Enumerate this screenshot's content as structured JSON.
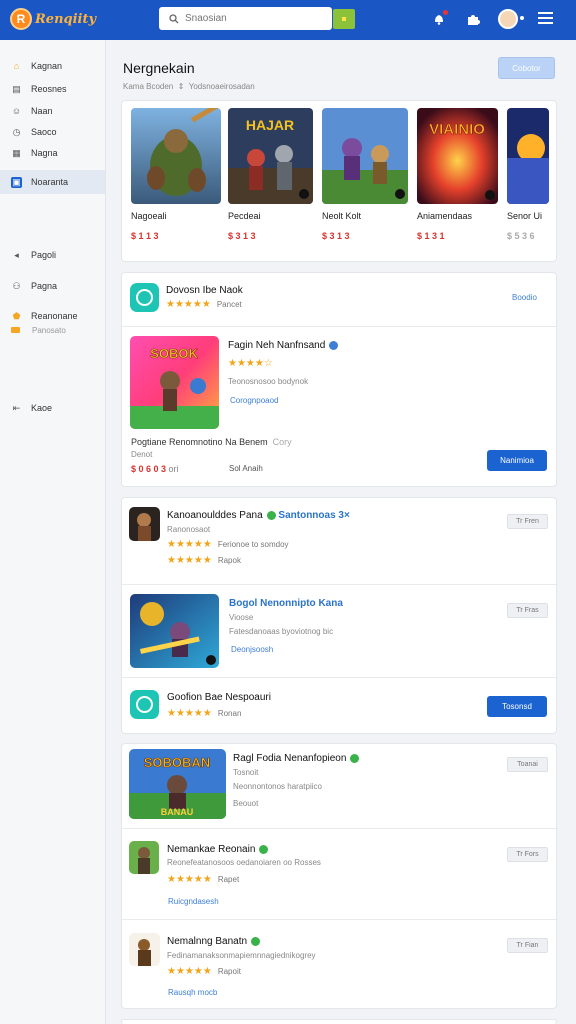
{
  "topbar": {
    "logo_text": "Renqiity",
    "logo_mark": "R",
    "search_placeholder": "Snaosian",
    "icons": [
      "notification-icon",
      "puzzle-icon",
      "avatar",
      "menu-icon"
    ]
  },
  "sidebar": {
    "items": [
      {
        "label": "Kagnan",
        "icon": "home-icon"
      },
      {
        "label": "Reosnes",
        "icon": "store-icon"
      },
      {
        "label": "Naan",
        "icon": "user-icon"
      },
      {
        "label": "Saoco",
        "icon": "clock-icon"
      },
      {
        "label": "Nagna",
        "icon": "grid-icon"
      },
      {
        "label": "Noaranta",
        "icon": "apps-icon"
      },
      {
        "label": "Pagoli",
        "icon": "back-icon"
      },
      {
        "label": "Pagna",
        "icon": "people-icon"
      },
      {
        "label": "Reanonane",
        "icon": "star-icon",
        "sub": "Panosato"
      },
      {
        "label": "Kaoe",
        "icon": "exit-icon"
      }
    ]
  },
  "header": {
    "title": "Nergnekain",
    "subtitle": "Kama Bcoden",
    "subtitle2": "Yodsnoaeirosadan",
    "button": "Cobotor"
  },
  "featured": [
    {
      "name": "Nagoeali",
      "price": "$ 1 1 3"
    },
    {
      "name": "Pecdeai",
      "price": "$ 3 1 3"
    },
    {
      "name": "Neolt Kolt",
      "price": "$ 3 1 3"
    },
    {
      "name": "Aniamendaas",
      "price": "$ 1 3 1"
    },
    {
      "name": "Senor Ui",
      "price": "$ 5 3 6"
    }
  ],
  "card2": {
    "app_title": "Dovosn Ibe Naok",
    "app_rating": "Pancet",
    "app_link": "Boodio",
    "game_title": "Fagin Neh Nanfnsand",
    "game_desc1": "Teonosnosoo bodynok",
    "game_link": "Corognpoaod",
    "meta_line": "Pogtiane Renomnotino Na Benem",
    "meta_trail": "Cory",
    "meta_sub": "Denot",
    "price": "$ 0 6 0 3",
    "price_unit": "ori",
    "sold": "Sol Anaih",
    "button": "Nanimioa"
  },
  "card3": {
    "row1_title": "Kanoanoulddes Pana",
    "row1_tag": "Santonnoas 3×",
    "row1_sub": "Ranonosaot",
    "row1_desc": "Ferionoe to somdoy",
    "row1_rating": "Rapok",
    "row1_btn": "Tr Fren",
    "row2_title": "Bogol Nenonnipto",
    "row2_tag": "Kana",
    "row2_sub": "Vioose",
    "row2_desc": "Fatesdanoaas byoviotnog bic",
    "row2_link": "Deonjsoosh",
    "row2_btn": "Tr Fras",
    "row3_title": "Goofion Bae Nespoauri",
    "row3_rating": "Ronan",
    "row3_btn": "Tosonsd"
  },
  "card4": {
    "row1_title": "Ragl Fodia Nenanfopieon",
    "row1_sub": "Tosnoit",
    "row1_desc": "Neonnontonos haratpiico",
    "row1_link": "Beouot",
    "row1_btn": "Toanai",
    "row2_title": "Nemankae Reonain",
    "row2_desc": "Reonefeatanosoos oedanoiaren oo Rosses",
    "row2_rating": "Rapet",
    "row2_link": "Ruicgndasesh",
    "row2_btn": "Tr Fors",
    "row3_title": "Nemalnng Banatn",
    "row3_desc": "Fedinamanaksonmapiemnnagiednikogrey",
    "row3_rating": "Rapoit",
    "row3_link": "Rausqh mocb",
    "row3_btn": "Tr Fian"
  },
  "colors": {
    "topbar": "#1a56c4",
    "accent": "#1a63d0",
    "price_red": "#d8322f",
    "star": "#f2a51a",
    "teal_icon": "#1ec5b5"
  }
}
